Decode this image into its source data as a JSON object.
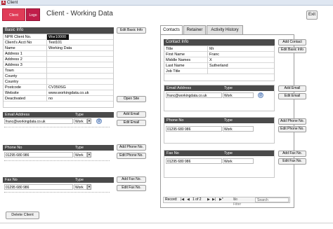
{
  "window": {
    "title": "Client",
    "app_icon": "access-app-icon"
  },
  "header": {
    "client_button": "Client",
    "logo_button": "Logo",
    "title": "Client - Working Data",
    "exit_button": "Exit"
  },
  "basic_info": {
    "heading": "Basic Info",
    "edit_button": "Edit Basic Info",
    "open_site_button": "Open Site",
    "fields": [
      {
        "label": "NPR Client No.",
        "value": "Wsr10000",
        "selected": true
      },
      {
        "label": "Client's Acct No",
        "value": "Test101"
      },
      {
        "label": "Name",
        "value": "Working Data"
      },
      {
        "label": "Address 1",
        "value": ""
      },
      {
        "label": "Address 2",
        "value": ""
      },
      {
        "label": "Address 3",
        "value": ""
      },
      {
        "label": "Town",
        "value": ""
      },
      {
        "label": "County",
        "value": ""
      },
      {
        "label": "Country",
        "value": ""
      },
      {
        "label": "Postcode",
        "value": "CV350SG"
      },
      {
        "label": "Website",
        "value": "www.workingdata.co.uk"
      },
      {
        "label": "Deactivated",
        "value": "no"
      }
    ]
  },
  "client_email": {
    "col1": "Email Address",
    "col2": "Type",
    "rows": [
      {
        "value": "franc@workingdata.co.uk",
        "type": "Work"
      }
    ],
    "add_button": "Add Email",
    "edit_button": "Edit Email"
  },
  "client_phone": {
    "col1": "Phone No",
    "col2": "Type",
    "rows": [
      {
        "value": "01295 680 986",
        "type": "Work"
      }
    ],
    "add_button": "Add Phone No.",
    "edit_button": "Edit Phone No."
  },
  "client_fax": {
    "col1": "Fax No",
    "col2": "Type",
    "rows": [
      {
        "value": "01295 680 986",
        "type": "Work"
      }
    ],
    "add_button": "Add Fax No.",
    "edit_button": "Edit Fax No."
  },
  "tabs": [
    "Contacts",
    "Retainer",
    "Activity History"
  ],
  "contact": {
    "heading": "Contact Info",
    "add_button": "Add Contact",
    "edit_button": "Edit Basic Info",
    "fields": [
      {
        "label": "Title",
        "value": "Mr"
      },
      {
        "label": "First Name",
        "value": "Franc"
      },
      {
        "label": "Middle Names",
        "value": "X"
      },
      {
        "label": "Last Name",
        "value": "Sutherland"
      },
      {
        "label": "Job Title",
        "value": ""
      }
    ],
    "email": {
      "col1": "Email Address",
      "col2": "Type",
      "rows": [
        {
          "value": "franc@workingdata.co.uk",
          "type": "Work"
        }
      ],
      "add_button": "Add Email",
      "edit_button": "Edit Email"
    },
    "phone": {
      "col1": "Phone No",
      "col2": "Type",
      "rows": [
        {
          "value": "01295 680 986",
          "type": "Work"
        }
      ],
      "add_button": "Add Phone No.",
      "edit_button": "Edit Phone No."
    },
    "fax": {
      "col1": "Fax No",
      "col2": "Type",
      "rows": [
        {
          "value": "01295 680 986",
          "type": "Work"
        }
      ],
      "add_button": "Add Fax No.",
      "edit_button": "Edit Fax No."
    }
  },
  "record_nav": {
    "label": "Record:",
    "first": "|◀",
    "prev": "◀",
    "position": "1 of 2",
    "next": "▶",
    "last": "▶|",
    "new": "▶*",
    "filter": "No Filter",
    "search_placeholder": "Search"
  },
  "footer": {
    "delete_button": "Delete Client"
  }
}
